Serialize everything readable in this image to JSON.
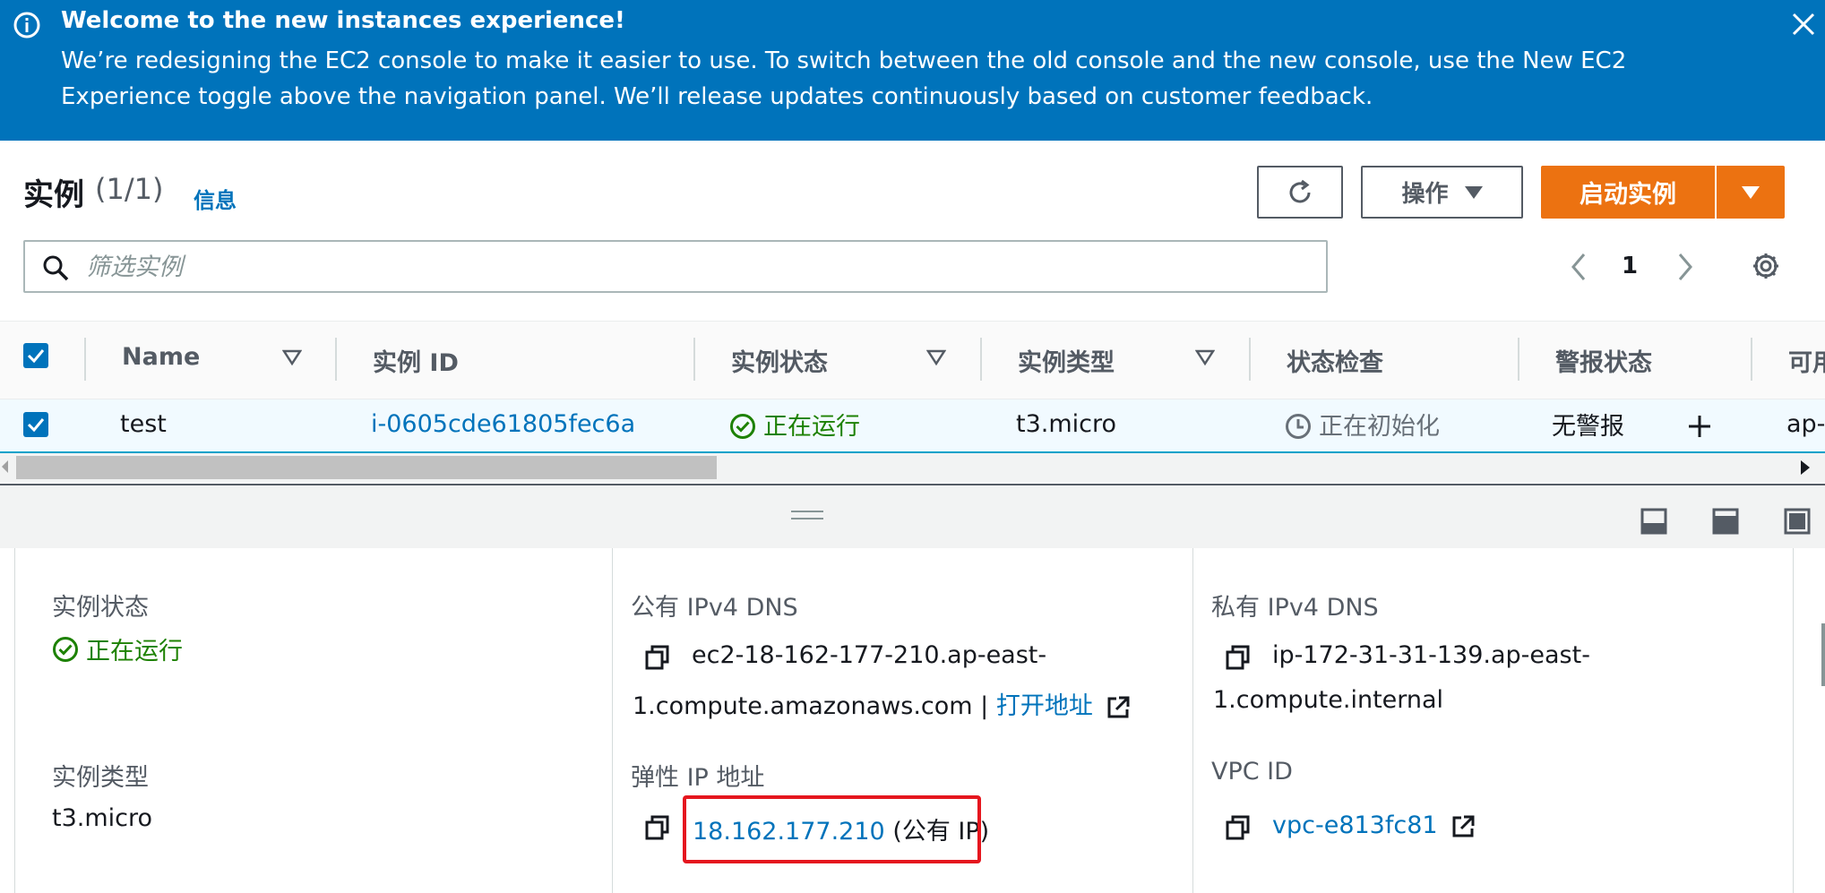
{
  "banner": {
    "title": "Welcome to the new instances experience!",
    "body": "We’re redesigning the EC2 console to make it easier to use. To switch between the old console and the new console, use the New EC2 Experience toggle above the navigation panel. We’ll release updates continuously based on customer feedback.",
    "icon": "info-icon",
    "close_icon": "close-icon",
    "background": "#0073bb"
  },
  "header": {
    "title": "实例",
    "count": "(1/1)",
    "info_link": "信息",
    "actions_label": "操作",
    "launch_label": "启动实例",
    "accent": "#ec7211"
  },
  "search": {
    "placeholder": "筛选实例"
  },
  "pager": {
    "page": "1"
  },
  "table": {
    "columns": [
      "Name",
      "实例 ID",
      "实例状态",
      "实例类型",
      "状态检查",
      "警报状态",
      "可用"
    ],
    "rows": [
      {
        "name": "test",
        "instance_id": "i-0605cde61805fec6a",
        "state": "正在运行",
        "type": "t3.micro",
        "status_check": "正在初始化",
        "alarm": "无警报",
        "az": "ap-"
      }
    ]
  },
  "details": {
    "state_label": "实例状态",
    "state_value": "正在运行",
    "type_label": "实例类型",
    "type_value": "t3.micro",
    "public_dns_label": "公有 IPv4 DNS",
    "public_dns_line1": "ec2-18-162-177-210.ap-east-",
    "public_dns_line2": "1.compute.amazonaws.com |",
    "open_address": "打开地址",
    "eip_label": "弹性 IP 地址",
    "eip_value": "18.162.177.210",
    "eip_suffix": "(公有 IP)",
    "private_dns_label": "私有 IPv4 DNS",
    "private_dns_line1": "ip-172-31-31-139.ap-east-",
    "private_dns_line2": "1.compute.internal",
    "vpc_label": "VPC ID",
    "vpc_value": "vpc-e813fc81"
  },
  "colors": {
    "link": "#0073bb",
    "success": "#1d8102",
    "highlight": "#e5161e"
  }
}
